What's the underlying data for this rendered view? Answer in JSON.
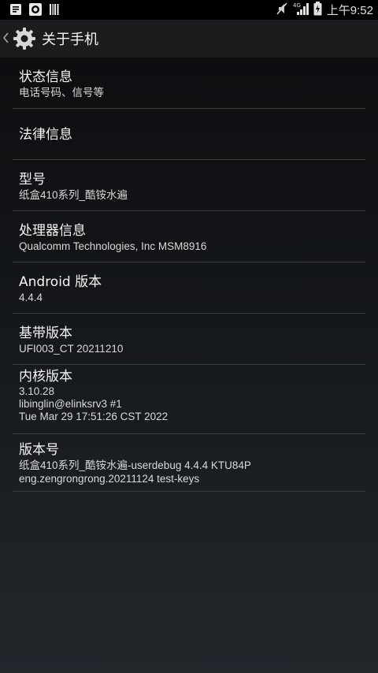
{
  "status_bar": {
    "time": "上午9:52",
    "network_label": "4G"
  },
  "action_bar": {
    "title": "关于手机"
  },
  "settings": {
    "items": [
      {
        "title": "状态信息",
        "lines": [
          "电话号码、信号等"
        ]
      },
      {
        "title": "法律信息",
        "lines": []
      },
      {
        "title": "型号",
        "lines": [
          "纸盒410系列_酷铵水遍"
        ]
      },
      {
        "title": "处理器信息",
        "lines": [
          "Qualcomm Technologies, Inc MSM8916"
        ]
      },
      {
        "title": "Android 版本",
        "lines": [
          "4.4.4"
        ]
      },
      {
        "title": "基带版本",
        "lines": [
          "UFI003_CT 20211210"
        ]
      },
      {
        "title": "内核版本",
        "lines": [
          "3.10.28",
          "libinglin@elinksrv3 #1",
          "Tue Mar 29 17:51:26 CST 2022"
        ]
      },
      {
        "title": "版本号",
        "lines": [
          "纸盒410系列_酷铵水遍-userdebug 4.4.4 KTU84P",
          "eng.zengrongrong.20211124 test-keys"
        ]
      }
    ]
  }
}
